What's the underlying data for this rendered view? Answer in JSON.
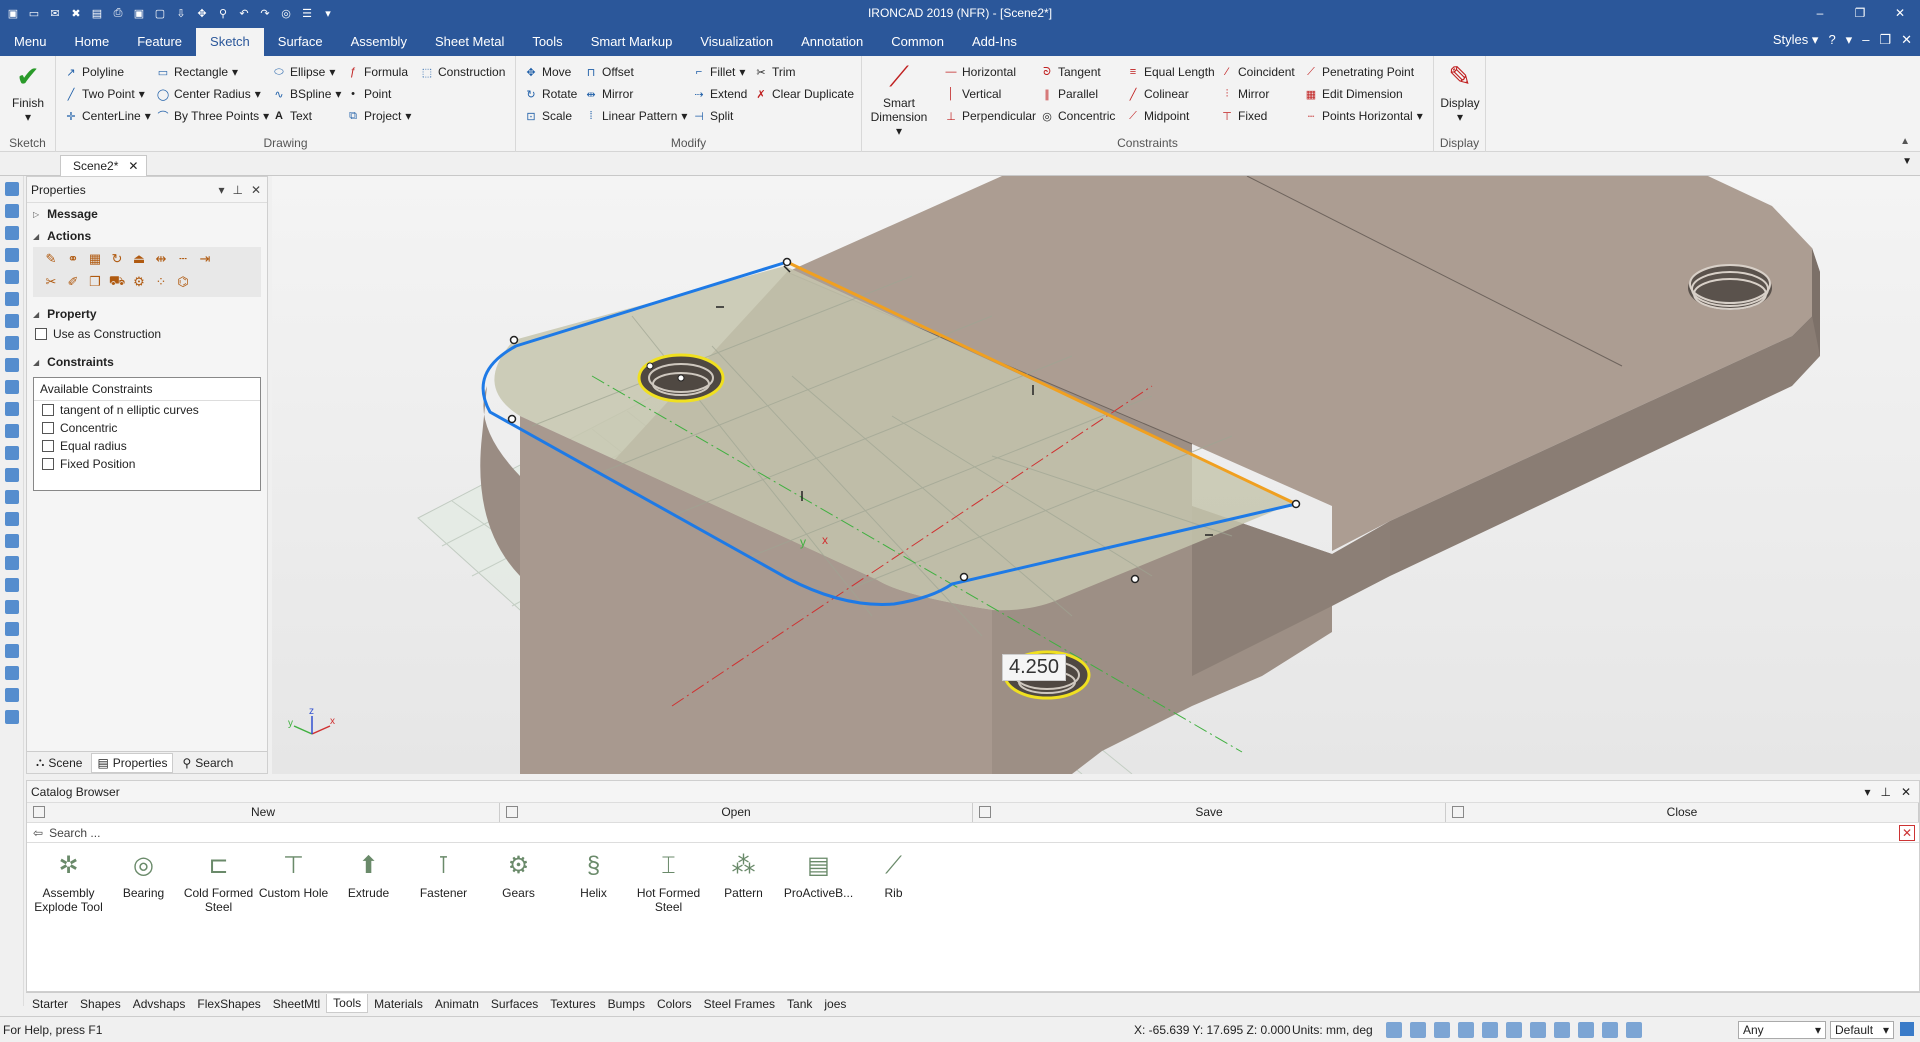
{
  "window": {
    "title": "IRONCAD 2019 (NFR) - [Scene2*]",
    "buttons": [
      "–",
      "❐",
      "✕"
    ]
  },
  "menubar": {
    "tabs": [
      "Menu",
      "Home",
      "Feature",
      "Sketch",
      "Surface",
      "Assembly",
      "Sheet Metal",
      "Tools",
      "Smart Markup",
      "Visualization",
      "Annotation",
      "Common",
      "Add-Ins"
    ],
    "active": "Sketch",
    "styles_label": "Styles"
  },
  "ribbon": {
    "sketch": {
      "finish": "Finish",
      "label": "Sketch"
    },
    "drawing": {
      "label": "Drawing",
      "polyline": "Polyline",
      "two_point": "Two Point",
      "centerline": "CenterLine",
      "rectangle": "Rectangle",
      "center_radius": "Center Radius",
      "by_three_points": "By Three Points",
      "ellipse": "Ellipse",
      "bspline": "BSpline",
      "text": "Text",
      "formula": "Formula",
      "point": "Point",
      "project": "Project",
      "construction": "Construction"
    },
    "modify": {
      "label": "Modify",
      "move": "Move",
      "rotate": "Rotate",
      "scale": "Scale",
      "offset": "Offset",
      "mirror": "Mirror",
      "linear_pattern": "Linear Pattern",
      "fillet": "Fillet",
      "extend": "Extend",
      "split": "Split",
      "trim": "Trim",
      "clear_duplicate": "Clear Duplicate"
    },
    "constraints": {
      "label": "Constraints",
      "smart_dimension": "Smart Dimension",
      "horizontal": "Horizontal",
      "vertical": "Vertical",
      "perpendicular": "Perpendicular",
      "tangent": "Tangent",
      "parallel": "Parallel",
      "concentric": "Concentric",
      "equal_length": "Equal Length",
      "colinear": "Colinear",
      "midpoint": "Midpoint",
      "coincident": "Coincident",
      "mirror": "Mirror",
      "fixed": "Fixed",
      "penetrating_point": "Penetrating Point",
      "edit_dimension": "Edit Dimension",
      "points_horizontal": "Points Horizontal"
    },
    "display": {
      "button": "Display",
      "label": "Display"
    }
  },
  "doc_tab": {
    "name": "Scene2*"
  },
  "properties": {
    "title": "Properties",
    "sections": {
      "message": "Message",
      "actions": "Actions",
      "property": "Property",
      "constraints": "Constraints"
    },
    "use_as_construction": "Use as Construction",
    "available_constraints_header": "Available Constraints",
    "available_constraints": [
      "tangent of n elliptic curves",
      "Concentric",
      "Equal radius",
      "Fixed Position"
    ],
    "bottom_tabs": [
      "Scene",
      "Properties",
      "Search"
    ],
    "active_tab": "Properties"
  },
  "viewport": {
    "dimension_label": "4.250",
    "triad": {
      "x": "x",
      "y": "y",
      "z": "z"
    }
  },
  "catalog": {
    "title": "Catalog Browser",
    "buttons": [
      "New",
      "Open",
      "Save",
      "Close"
    ],
    "search_placeholder": "Search ...",
    "items": [
      "Assembly Explode Tool",
      "Bearing",
      "Cold Formed Steel",
      "Custom Hole",
      "Extrude",
      "Fastener",
      "Gears",
      "Helix",
      "Hot Formed Steel",
      "Pattern",
      "ProActiveB...",
      "Rib"
    ],
    "tabs": [
      "Starter",
      "Shapes",
      "Advshaps",
      "FlexShapes",
      "SheetMtl",
      "Tools",
      "Materials",
      "Animatn",
      "Surfaces",
      "Textures",
      "Bumps",
      "Colors",
      "Steel Frames",
      "Tank",
      "joes"
    ],
    "active_tab": "Tools"
  },
  "status": {
    "help": "For Help, press F1",
    "coords": "X: -65.639 Y: 17.695 Z: 0.000",
    "units": "Units: mm, deg",
    "filter": "Any",
    "style": "Default"
  },
  "colors": {
    "title_bar": "#2b579a",
    "sketch_profile": "#1e7ae6",
    "selected_edge": "#f0a020",
    "hole_highlight": "#f0e020",
    "part": "#a79a8e"
  }
}
